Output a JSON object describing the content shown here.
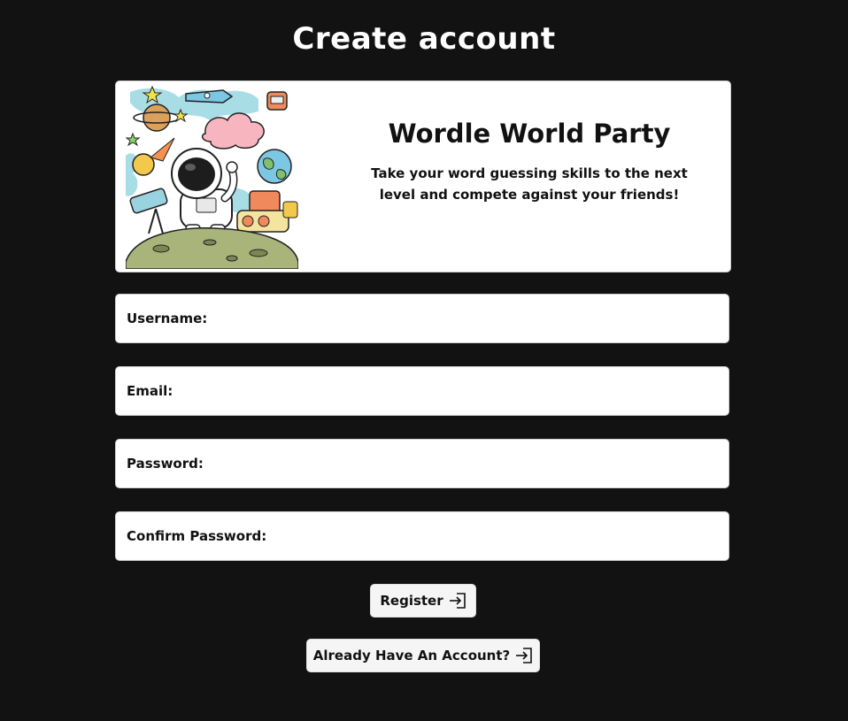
{
  "page": {
    "title": "Create account"
  },
  "hero": {
    "title": "Wordle World Party",
    "subtitle": "Take your word guessing skills to the next level and compete against your friends!",
    "illustration_icon": "astronaut-space-illustration"
  },
  "form": {
    "username_label": "Username:",
    "email_label": "Email:",
    "password_label": "Password:",
    "confirm_password_label": "Confirm Password:",
    "username_value": "",
    "email_value": "",
    "password_value": "",
    "confirm_password_value": ""
  },
  "actions": {
    "register_label": "Register",
    "register_icon": "sign-in-icon",
    "login_label": "Already Have An Account?",
    "login_icon": "sign-in-icon"
  },
  "colors": {
    "background": "#121212",
    "card": "#ffffff",
    "button": "#f5f5f5",
    "text": "#111111"
  }
}
